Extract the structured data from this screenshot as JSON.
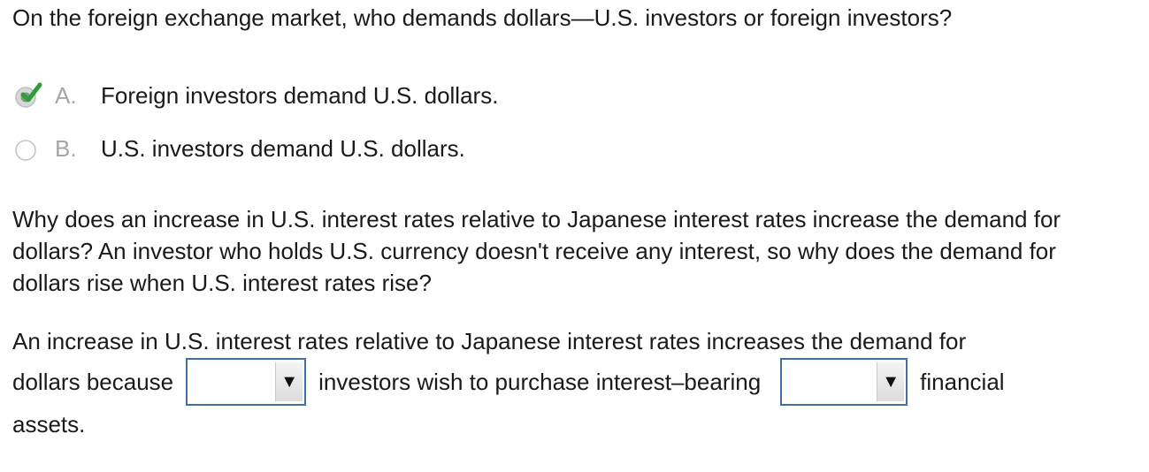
{
  "question1": {
    "text": "On the foreign exchange market, who demands dollars—U.S. investors or foreign investors?"
  },
  "options": [
    {
      "letter": "A.",
      "text": "Foreign investors demand U.S. dollars.",
      "selected": true,
      "correct": true
    },
    {
      "letter": "B.",
      "text": "U.S. investors demand U.S. dollars.",
      "selected": false
    }
  ],
  "question2": {
    "text": "Why does an increase in U.S. interest rates relative to Japanese interest rates increase the demand for dollars? An investor who holds U.S. currency doesn't receive any interest, so why does the demand for dollars rise when U.S. interest rates rise?"
  },
  "fill_in": {
    "line1": "An increase in U.S. interest rates relative to Japanese interest rates increases the demand for",
    "part1": "dollars because",
    "dropdown1": {
      "value": ""
    },
    "part2": "investors wish to purchase interest–bearing",
    "dropdown2": {
      "value": ""
    },
    "part3": "financial",
    "part4": "assets."
  },
  "icons": {
    "dropdown_arrow": "▼"
  },
  "colors": {
    "check_green": "#2e9e3a",
    "dropdown_border": "#3f6ea8",
    "letter_gray": "#a6a6a6"
  }
}
